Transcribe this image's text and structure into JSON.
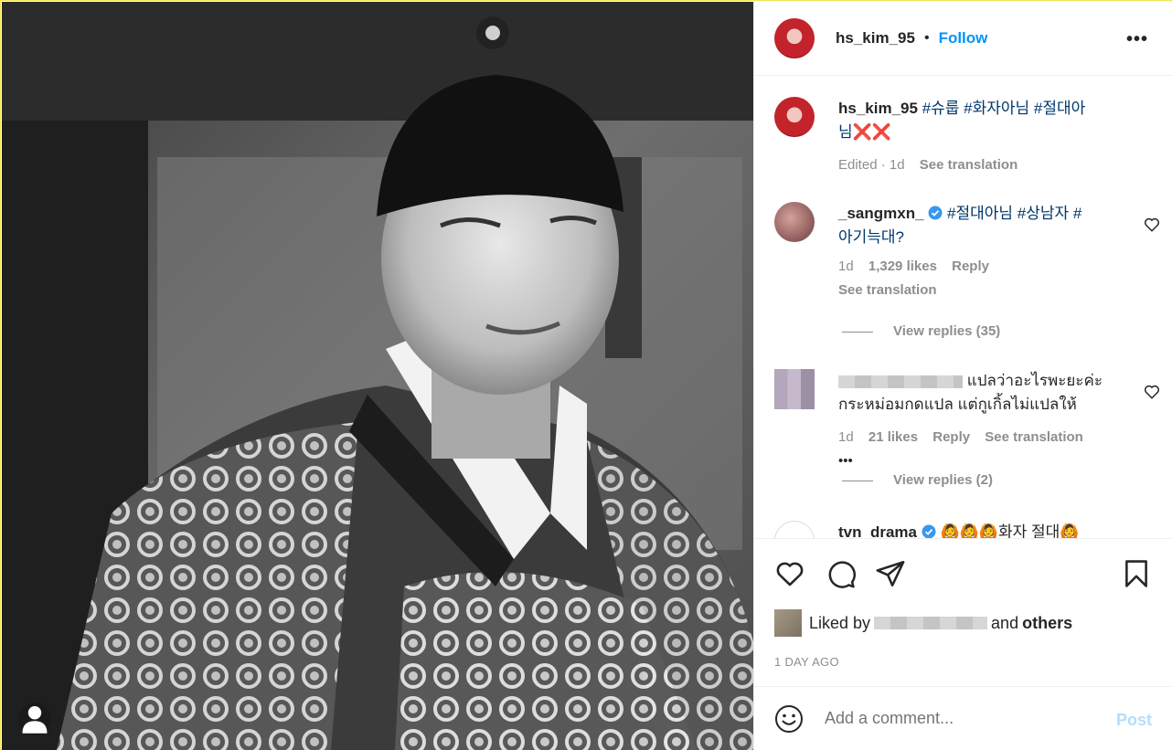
{
  "post": {
    "username": "hs_kim_95",
    "follow_label": "Follow",
    "more_icon": "more-horizontal-icon"
  },
  "caption": {
    "username": "hs_kim_95",
    "text_part1": "#슈룹 #화자아님 #절대아",
    "text_part2": "님",
    "emoji": "❌❌",
    "edited": "Edited · 1d",
    "translate": "See translation"
  },
  "comments": [
    {
      "username": "_sangmxn_",
      "verified": true,
      "text_line1": "#절대아님 #상남자 #",
      "text_line2": "아기늑대?",
      "time": "1d",
      "likes": "1,329 likes",
      "reply": "Reply",
      "translate": "See translation",
      "view_replies": "View replies (35)"
    },
    {
      "username_hidden": true,
      "text_line1": "แปลว่าอะไรพะยะค่ะ",
      "text_line2": "กระหม่อมกดแปล แต่กูเกิ้ลไม่แปลให้",
      "time": "1d",
      "likes": "21 likes",
      "reply": "Reply",
      "translate": "See translation",
      "more": "•••",
      "view_replies": "View replies (2)"
    },
    {
      "username": "tvn_drama",
      "verified": true,
      "text_line1": "🙆🙆🙆화자 절대🙆"
    }
  ],
  "actions": {
    "like_icon": "heart-icon",
    "comment_icon": "comment-icon",
    "share_icon": "send-icon",
    "save_icon": "bookmark-icon"
  },
  "likes": {
    "prefix": "Liked by",
    "middle": "and",
    "suffix": "others"
  },
  "date": "1 DAY AGO",
  "add_comment": {
    "placeholder": "Add a comment...",
    "post_label": "Post",
    "emoji_icon": "smiley-icon"
  },
  "colors": {
    "accent": "#0095f6",
    "link": "#00376b",
    "muted": "#8e8e8e",
    "post_disabled": "#b2dffc"
  }
}
